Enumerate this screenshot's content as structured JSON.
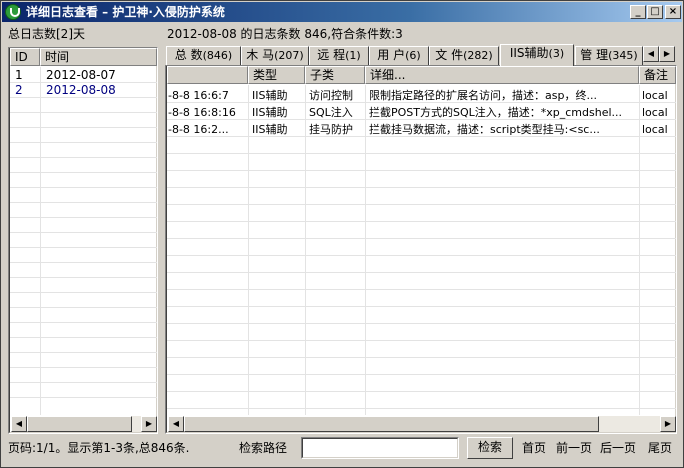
{
  "window": {
    "title": "详细日志查看 – 护卫神·入侵防护系统",
    "min": "_",
    "max": "□",
    "close": "×"
  },
  "left": {
    "total_label": "总日志数[2]天",
    "columns": [
      "ID",
      "时间"
    ],
    "rows": [
      {
        "id": "1",
        "time": "2012-08-07"
      },
      {
        "id": "2",
        "time": "2012-08-08"
      }
    ]
  },
  "right": {
    "summary": "2012-08-08 的日志条数 846,符合条件数:3",
    "tabs": [
      {
        "label": "总 数",
        "count": "(846)"
      },
      {
        "label": "木 马",
        "count": "(207)"
      },
      {
        "label": "远 程",
        "count": "(1)"
      },
      {
        "label": "用 户",
        "count": "(6)"
      },
      {
        "label": "文 件",
        "count": "(282)"
      },
      {
        "label": "IIS辅助",
        "count": "(3)"
      },
      {
        "label": "管 理",
        "count": "(345)"
      }
    ],
    "active_tab": 5,
    "columns": [
      "",
      "类型",
      "子类",
      "详细...",
      "备注"
    ],
    "rows": [
      {
        "time": "-8-8 16:6:7",
        "type": "IIS辅助",
        "sub": "访问控制",
        "detail": "限制指定路径的扩展名访问，描述：asp，终...",
        "note": "local"
      },
      {
        "time": "-8-8 16:8:16",
        "type": "IIS辅助",
        "sub": "SQL注入",
        "detail": "拦截POST方式的SQL注入，描述：*xp_cmdshel...",
        "note": "local"
      },
      {
        "time": "-8-8 16:2...",
        "type": "IIS辅助",
        "sub": "挂马防护",
        "detail": "拦截挂马数据流，描述：script类型挂马:<sc...",
        "note": "local"
      }
    ]
  },
  "footer": {
    "page_info": "页码:1/1。显示第1-3条,总846条.",
    "search_label": "检索路径",
    "search_value": "",
    "search_button": "检索",
    "first": "首页",
    "prev": "前一页",
    "next": "后一页",
    "last": "尾页"
  },
  "icons": {
    "left_arrow": "◀",
    "right_arrow": "▶"
  }
}
